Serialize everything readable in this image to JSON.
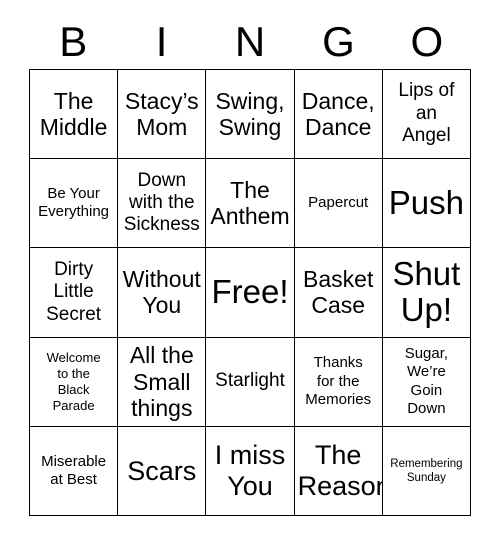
{
  "card": {
    "type": "bingo-card",
    "columns": 5,
    "rows": 5,
    "background_color": "#ffffff",
    "text_color": "#000000",
    "border_color": "#000000"
  },
  "header": {
    "letters": [
      "B",
      "I",
      "N",
      "G",
      "O"
    ]
  },
  "grid": {
    "rows": [
      [
        {
          "text": "The\nMiddle",
          "size": "lg"
        },
        {
          "text": "Stacy’s\nMom",
          "size": "lg"
        },
        {
          "text": "Swing,\nSwing",
          "size": "lg"
        },
        {
          "text": "Dance,\nDance",
          "size": "lg"
        },
        {
          "text": "Lips of\nan\nAngel",
          "size": "md"
        }
      ],
      [
        {
          "text": "Be Your\nEverything",
          "size": "sm"
        },
        {
          "text": "Down\nwith the\nSickness",
          "size": "md"
        },
        {
          "text": "The\nAnthem",
          "size": "lg"
        },
        {
          "text": "Papercut",
          "size": "sm"
        },
        {
          "text": "Push",
          "size": "xxl"
        }
      ],
      [
        {
          "text": "Dirty\nLittle\nSecret",
          "size": "md"
        },
        {
          "text": "Without\nYou",
          "size": "lg"
        },
        {
          "text": "Free!",
          "size": "xxl"
        },
        {
          "text": "Basket\nCase",
          "size": "lg"
        },
        {
          "text": "Shut\nUp!",
          "size": "xxl"
        }
      ],
      [
        {
          "text": "Welcome\nto the\nBlack\nParade",
          "size": "xs"
        },
        {
          "text": "All the\nSmall\nthings",
          "size": "lg"
        },
        {
          "text": "Starlight",
          "size": "md"
        },
        {
          "text": "Thanks\nfor the\nMemories",
          "size": "sm"
        },
        {
          "text": "Sugar,\nWe’re\nGoin\nDown",
          "size": "sm"
        }
      ],
      [
        {
          "text": "Miserable\nat Best",
          "size": "sm"
        },
        {
          "text": "Scars",
          "size": "xl"
        },
        {
          "text": "I miss\nYou",
          "size": "xl"
        },
        {
          "text": "The\nReason",
          "size": "xl"
        },
        {
          "text": "Remembering\nSunday",
          "size": "xxs"
        }
      ]
    ]
  }
}
